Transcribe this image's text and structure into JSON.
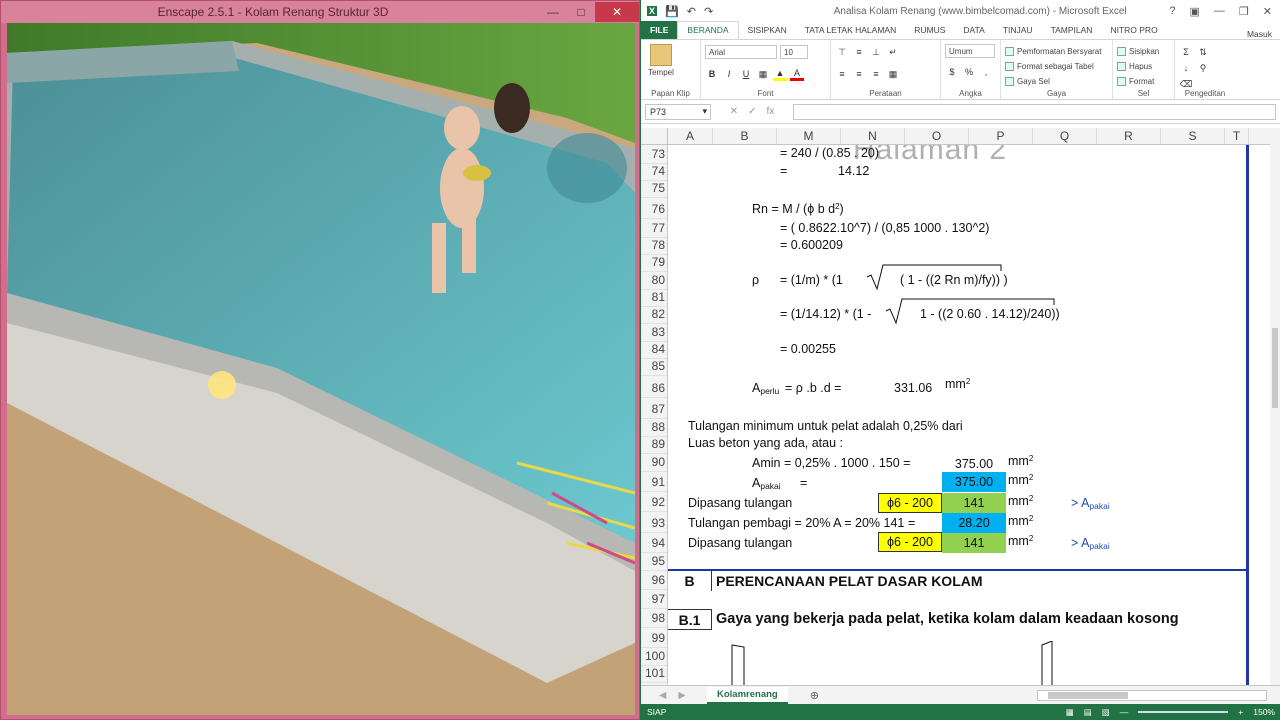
{
  "enscape": {
    "title": "Enscape 2.5.1 - Kolam Renang Struktur 3D"
  },
  "excel": {
    "title": "Analisa Kolam Renang (www.bimbelcomad.com) - Microsoft Excel",
    "user": "Masuk",
    "tabs": [
      "FILE",
      "BERANDA",
      "SISIPKAN",
      "TATA LETAK HALAMAN",
      "RUMUS",
      "DATA",
      "TINJAU",
      "TAMPILAN",
      "NITRO PRO"
    ],
    "ribbon": {
      "clipboard": {
        "paste": "Tempel",
        "label": "Papan Klip"
      },
      "font": {
        "name": "Arial",
        "size": "10",
        "label": "Font"
      },
      "alignment": {
        "label": "Perataan"
      },
      "number": {
        "format": "Umum",
        "label": "Angka"
      },
      "styles": {
        "cond": "Pemformatan Bersyarat",
        "table": "Format sebagai Tabel",
        "cell": "Gaya Sel",
        "label": "Gaya"
      },
      "cells": {
        "insert": "Sisipkan",
        "delete": "Hapus",
        "format": "Format",
        "label": "Sel"
      },
      "editing": {
        "label": "Pengeditan"
      }
    },
    "namebox": "P73",
    "columns": [
      "A",
      "B",
      "M",
      "N",
      "O",
      "P",
      "Q",
      "R",
      "S",
      "T"
    ],
    "rows": [
      "73",
      "74",
      "75",
      "76",
      "77",
      "78",
      "79",
      "80",
      "81",
      "82",
      "83",
      "84",
      "85",
      "86",
      "87",
      "88",
      "89",
      "90",
      "91",
      "92",
      "93",
      "94",
      "95",
      "96",
      "97",
      "98",
      "99",
      "100",
      "101"
    ],
    "watermark": "Halaman 2",
    "cells": {
      "r73": "=   240 / (0.85 . 20)",
      "r74_eq": "=",
      "r74_val": "14.12",
      "r76_rn": "Rn   =  M  / (ϕ b d",
      "r76_close": ")",
      "r76_exp": "2",
      "r77": "=   ( 0.8622.10^7) / (0,85 1000 . 130^2)",
      "r78": "=        0.600209",
      "r80_rho": "ρ",
      "r80_eq": "=   (1/m) *  (1",
      "r80_in": "( 1 - ((2 Rn m)/fy)) )",
      "r82_eq": "=   (1/14.12) * (1 -",
      "r82_in": "1 - ((2 0.60 . 14.12)/240))",
      "r84": "=        0.00255",
      "r86_a": "A",
      "r86_sub": "perlu",
      "r86_eq": "=    ρ .b .d   =",
      "r86_val": "331.06",
      "r86_unit": "mm",
      "r88": "Tulangan minimum untuk pelat adalah 0,25% dari",
      "r89": "Luas beton yang ada, atau  :",
      "r90_lbl": "Amin =  0,25% . 1000 . 150  =",
      "r90_val": "375.00",
      "r91_a": "A",
      "r91_sub": "pakai",
      "r91_eq": "=",
      "r91_val": "375.00",
      "r92_lbl": "Dipasang   tulangan",
      "r92_bar": "ϕ6 - 200",
      "r92_val": "141",
      "r92_note": "> A",
      "r93_lbl": "Tulangan pembagi = 20% A  =  20% 141  =",
      "r93_val": "28.20",
      "r94_lbl": "Dipasang   tulangan",
      "r94_bar": "ϕ6 - 200",
      "r94_val": "141",
      "r94_note": "> A",
      "unit_mm": "mm",
      "unit_exp": "2",
      "note_sub": "pakai",
      "r96_no": "B",
      "r96_title": "PERENCANAAN PELAT DASAR KOLAM",
      "r98_no": "B.1",
      "r98_title": "Gaya yang bekerja pada pelat, ketika kolam dalam keadaan kosong"
    },
    "sheet_tab": "Kolamrenang",
    "status": "SIAP",
    "zoom": "150%"
  },
  "colors": {
    "excel_green": "#217346",
    "yellow": "#ffff00",
    "cyan": "#00b0f0",
    "green": "#92d050",
    "enscape_pink": "#d26e8c"
  }
}
